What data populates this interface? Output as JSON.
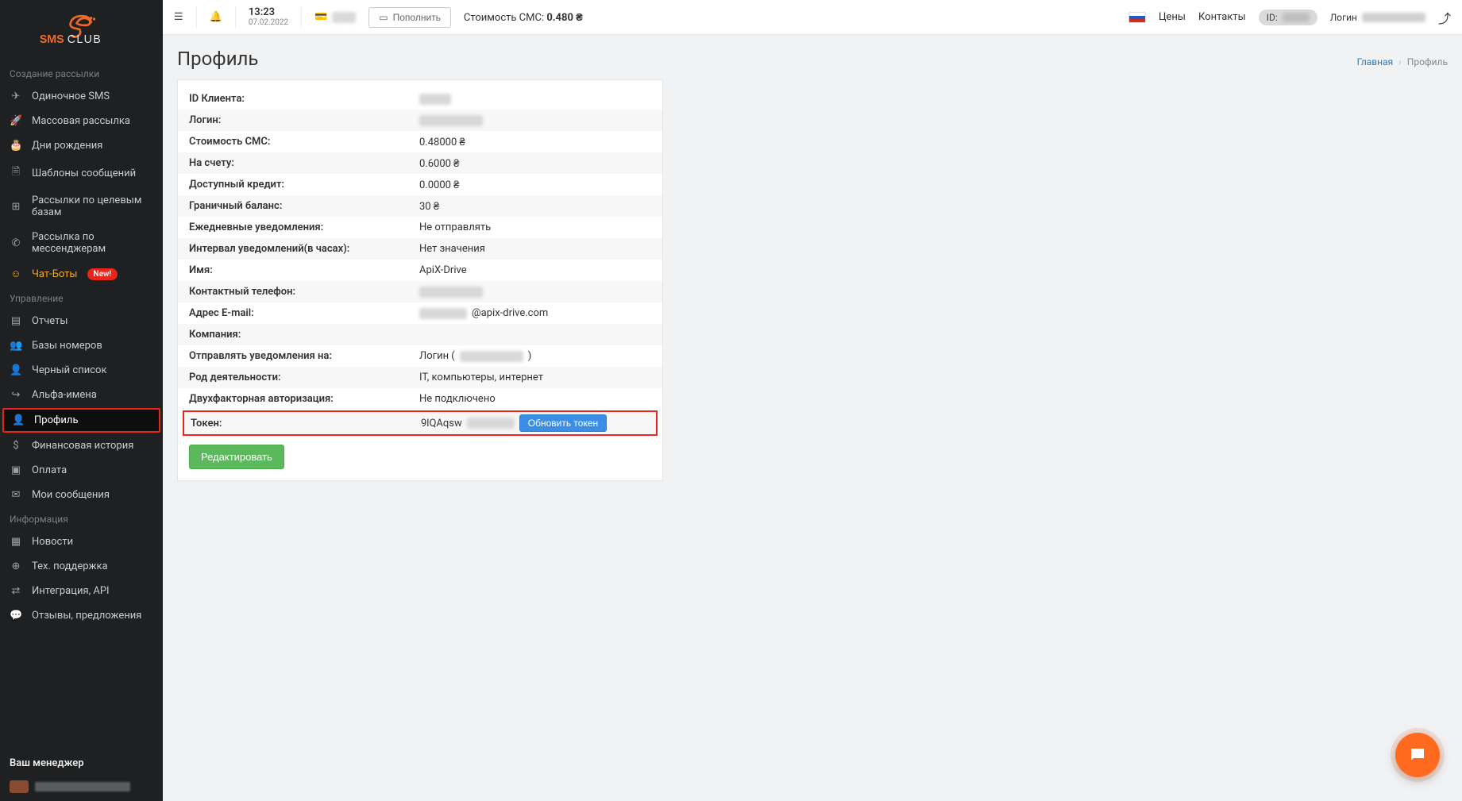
{
  "header": {
    "time": "13:23",
    "date": "07.02.2022",
    "topup_label": "Пополнить",
    "cost_prefix": "Стоимость СМС:",
    "cost_value": "0.480 ₴",
    "prices_link": "Цены",
    "contacts_link": "Контакты",
    "id_label": "ID:",
    "login_label": "Логин"
  },
  "sidebar": {
    "section_create": "Создание рассылки",
    "section_manage": "Управление",
    "section_info": "Информация",
    "items_create": [
      "Одиночное SMS",
      "Массовая рассылка",
      "Дни рождения",
      "Шаблоны сообщений",
      "Рассылки по целевым базам",
      "Рассылка по мессенджерам",
      "Чат-Боты"
    ],
    "badge_new": "New!",
    "items_manage": [
      "Отчеты",
      "Базы номеров",
      "Черный список",
      "Альфа-имена",
      "Профиль",
      "Финансовая история",
      "Оплата",
      "Мои сообщения"
    ],
    "items_info": [
      "Новости",
      "Тех. поддержка",
      "Интеграция, API",
      "Отзывы, предложения"
    ],
    "manager_title": "Ваш менеджер"
  },
  "page": {
    "title": "Профиль",
    "breadcrumb_home": "Главная",
    "breadcrumb_current": "Профиль"
  },
  "profile": {
    "fields": [
      {
        "k": "ID Клиента:",
        "blur": "sm"
      },
      {
        "k": "Логин:",
        "blur": "md"
      },
      {
        "k": "Стоимость СМС:",
        "v": "0.48000 ₴"
      },
      {
        "k": "На счету:",
        "v": "0.6000 ₴"
      },
      {
        "k": "Доступный кредит:",
        "v": "0.0000 ₴"
      },
      {
        "k": "Граничный баланс:",
        "v": "30 ₴"
      },
      {
        "k": "Ежедневные уведомления:",
        "v": "Не отправлять"
      },
      {
        "k": "Интервал уведомлений(в часах):",
        "v": "Нет значения"
      },
      {
        "k": "Имя:",
        "v": "ApiX-Drive"
      },
      {
        "k": "Контактный телефон:",
        "blur": "md"
      },
      {
        "k": "Адрес E-mail:",
        "email_domain": "@apix-drive.com",
        "blur": "lg"
      },
      {
        "k": "Компания:",
        "v": ""
      },
      {
        "k": "Отправлять уведомления на:",
        "login_prefix": "Логин (",
        "login_suffix": ")",
        "blur": "md"
      },
      {
        "k": "Род деятельности:",
        "v": "IT, компьютеры, интернет"
      },
      {
        "k": "Двухфакторная авторизация:",
        "v": "Не подключено"
      }
    ],
    "token_label": "Токен:",
    "token_visible": "9lQAqsw",
    "token_refresh": "Обновить токен",
    "edit_label": "Редактировать"
  }
}
